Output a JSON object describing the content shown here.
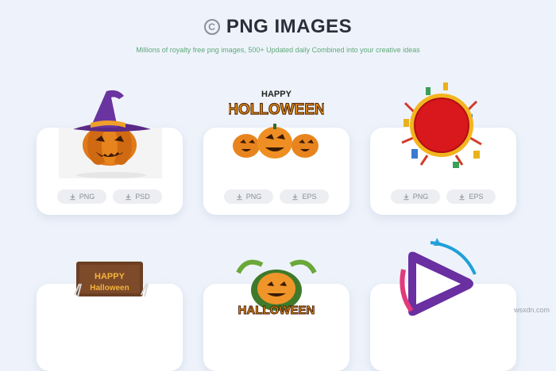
{
  "header": {
    "title": "PNG IMAGES",
    "copyright_symbol": "C",
    "subtitle": "Millions of royalty free png images, 500+ Updated daily Combined into your creative ideas"
  },
  "cards": [
    {
      "name": "pumpkin-witch-hat",
      "buttons": [
        "PNG",
        "PSD"
      ]
    },
    {
      "name": "happy-halloween-pumpkins",
      "buttons": [
        "PNG",
        "EPS"
      ]
    },
    {
      "name": "red-circle-fireworks-frame",
      "buttons": [
        "PNG",
        "EPS"
      ]
    }
  ],
  "art_text": {
    "happy": "HAPPY",
    "holloween": "HOLLOWEEN",
    "sign_happy": "HAPPY",
    "sign_halloween": "Halloween",
    "badge_halloween": "HALLOWEEN"
  },
  "watermark": "wsxdn.com",
  "icons": {
    "download": "download-icon",
    "copyright": "copyright-icon"
  }
}
